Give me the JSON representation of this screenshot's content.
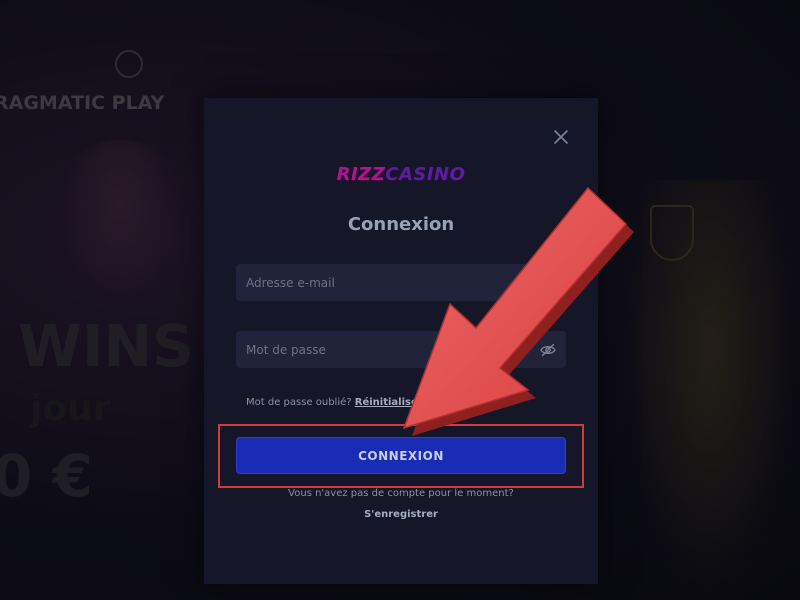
{
  "background": {
    "provider_logo": "RAGMATIC PLAY",
    "promo_line_1": "WINS",
    "promo_line_2": "jour",
    "promo_line_3": "0 €"
  },
  "modal": {
    "brand_part1": "RIZZ",
    "brand_part2": "CASINO",
    "title": "Connexion",
    "email_placeholder": "Adresse e-mail",
    "email_value": "",
    "password_placeholder": "Mot de passe",
    "password_value": "",
    "forgot_text": "Mot de passe oublié?",
    "forgot_link": "Réinitialiser",
    "login_button": "CONNEXION",
    "no_account_text": "Vous n'avez pas de compte pour le moment?",
    "register_link": "S'enregistrer"
  },
  "icons": {
    "close": "close-icon",
    "eye": "eye-off-icon"
  },
  "colors": {
    "login_button": "#1a2cb3",
    "highlight": "#d23b3b",
    "arrow": "#e85050",
    "brand_pink": "#b2148f",
    "brand_purple": "#5e1d9e"
  }
}
